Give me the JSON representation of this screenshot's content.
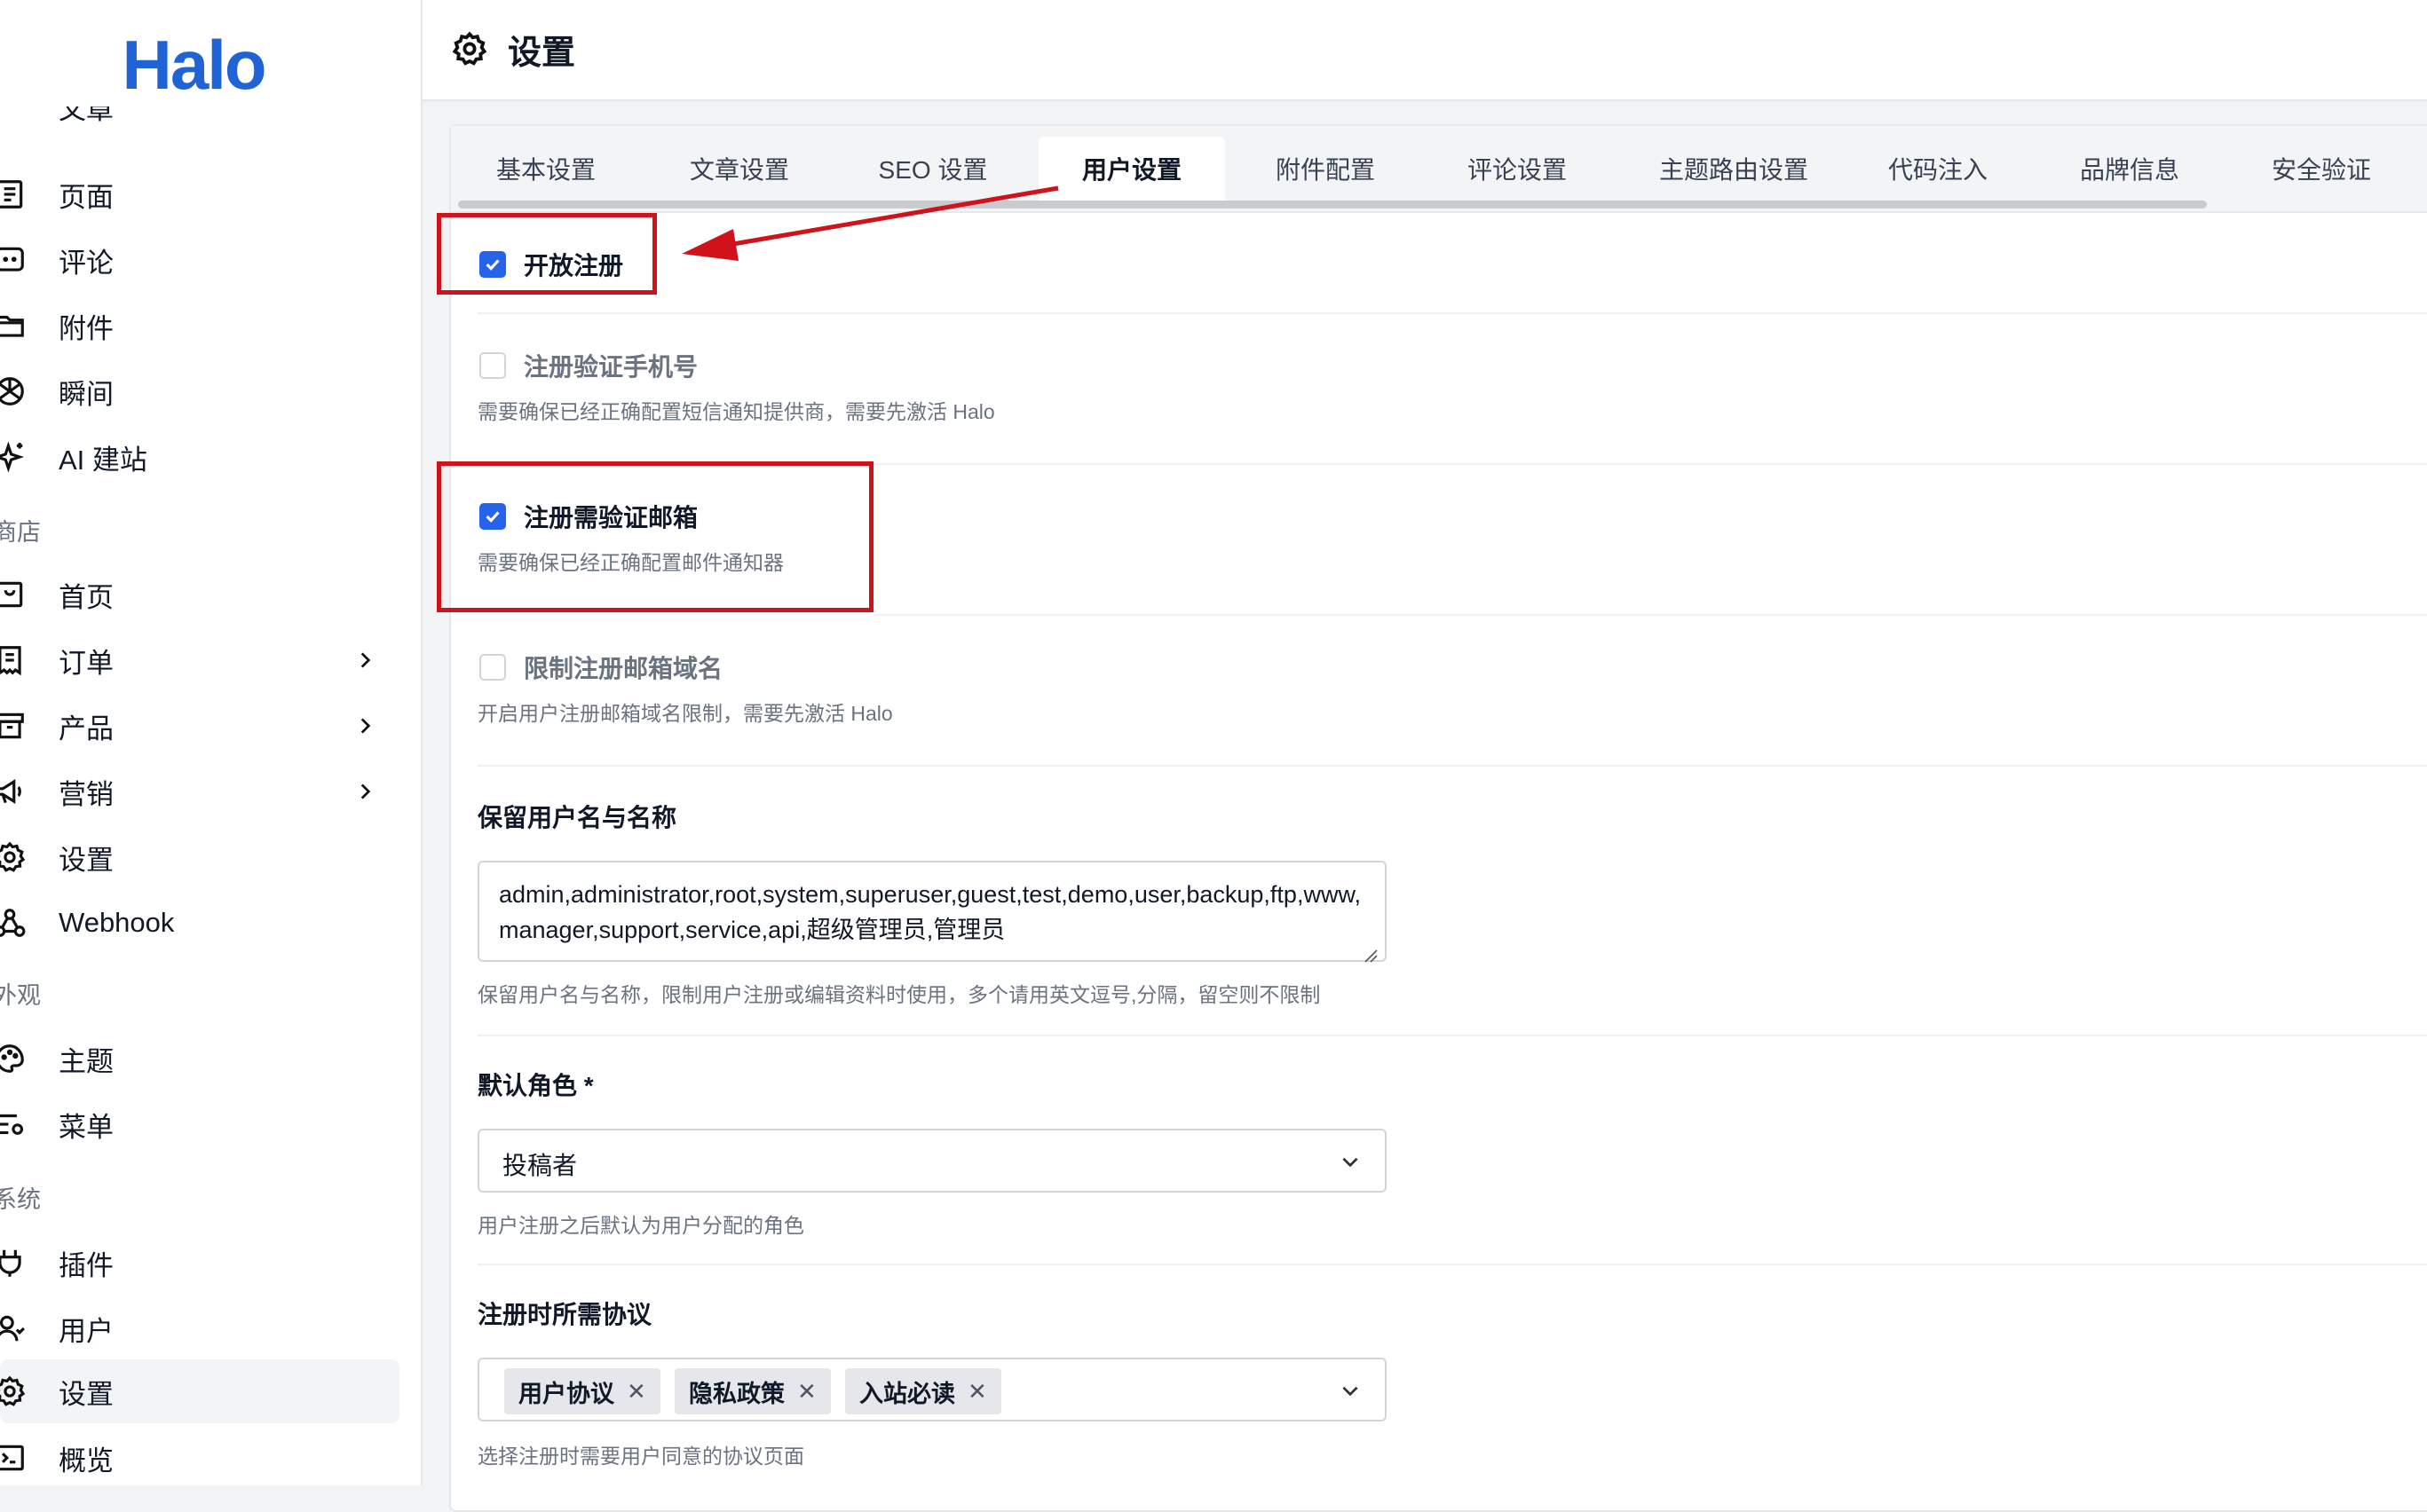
{
  "sidebar": {
    "logo": "Halo",
    "partial_item": "文章",
    "items_a": [
      {
        "label": "页面",
        "icon": "page-icon"
      },
      {
        "label": "评论",
        "icon": "comment-icon"
      },
      {
        "label": "附件",
        "icon": "folder-icon"
      },
      {
        "label": "瞬间",
        "icon": "moment-icon"
      },
      {
        "label": "AI 建站",
        "icon": "sparkle-icon"
      }
    ],
    "group_store": "商店",
    "items_store": [
      {
        "label": "首页",
        "icon": "home-icon"
      },
      {
        "label": "订单",
        "icon": "order-icon"
      },
      {
        "label": "产品",
        "icon": "product-icon"
      },
      {
        "label": "营销",
        "icon": "megaphone-icon"
      },
      {
        "label": "设置",
        "icon": "gear-icon"
      },
      {
        "label": "Webhook",
        "icon": "webhook-icon"
      }
    ],
    "group_appearance": "外观",
    "items_appearance": [
      {
        "label": "主题",
        "icon": "palette-icon"
      },
      {
        "label": "菜单",
        "icon": "menu-settings-icon"
      }
    ],
    "group_system": "系统",
    "items_system": [
      {
        "label": "插件",
        "icon": "plug-icon"
      },
      {
        "label": "用户",
        "icon": "user-icon"
      },
      {
        "label": "设置",
        "icon": "gear-icon"
      },
      {
        "label": "概览",
        "icon": "terminal-icon"
      }
    ]
  },
  "header": {
    "title": "设置"
  },
  "tabs": [
    "基本设置",
    "文章设置",
    "SEO 设置",
    "用户设置",
    "附件配置",
    "评论设置",
    "主题路由设置",
    "代码注入",
    "品牌信息",
    "安全验证"
  ],
  "active_tab": "用户设置",
  "form": {
    "open_register": {
      "label": "开放注册",
      "checked": true
    },
    "verify_phone": {
      "label": "注册验证手机号",
      "checked": false,
      "help": "需要确保已经正确配置短信通知提供商，需要先激活 Halo"
    },
    "verify_email": {
      "label": "注册需验证邮箱",
      "checked": true,
      "help": "需要确保已经正确配置邮件通知器"
    },
    "restrict_domain": {
      "label": "限制注册邮箱域名",
      "checked": false,
      "help": "开启用户注册邮箱域名限制，需要先激活 Halo"
    },
    "reserved_names": {
      "label": "保留用户名与名称",
      "value": "admin,administrator,root,system,superuser,guest,test,demo,user,backup,ftp,www,manager,support,service,api,超级管理员,管理员",
      "help": "保留用户名与名称，限制用户注册或编辑资料时使用，多个请用英文逗号,分隔，留空则不限制"
    },
    "default_role": {
      "label": "默认角色 *",
      "value": "投稿者",
      "help": "用户注册之后默认为用户分配的角色"
    },
    "agreements": {
      "label": "注册时所需协议",
      "tags": [
        "用户协议",
        "隐私政策",
        "入站必读"
      ],
      "help": "选择注册时需要用户同意的协议页面"
    }
  },
  "colors": {
    "accent": "#2563eb",
    "logo": "#1f63d6",
    "annotation": "#d0121b"
  }
}
